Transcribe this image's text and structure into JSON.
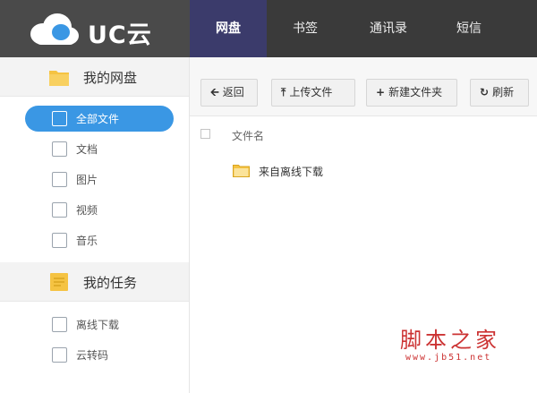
{
  "app": {
    "logo_text": "UC云",
    "logo_icon": "cloud-logo-icon"
  },
  "nav": {
    "items": [
      {
        "label": "网盘",
        "active": true
      },
      {
        "label": "书签",
        "active": false
      },
      {
        "label": "通讯录",
        "active": false
      },
      {
        "label": "短信",
        "active": false
      }
    ]
  },
  "sidebar": {
    "disk": {
      "title": "我的网盘",
      "items": [
        {
          "label": "全部文件",
          "icon": "all-files-icon",
          "active": true
        },
        {
          "label": "文档",
          "icon": "document-icon",
          "active": false
        },
        {
          "label": "图片",
          "icon": "picture-icon",
          "active": false
        },
        {
          "label": "视频",
          "icon": "video-icon",
          "active": false
        },
        {
          "label": "音乐",
          "icon": "music-icon",
          "active": false
        }
      ]
    },
    "tasks": {
      "title": "我的任务",
      "items": [
        {
          "label": "离线下载",
          "icon": "offline-download-icon"
        },
        {
          "label": "云转码",
          "icon": "cloud-transcode-icon"
        }
      ]
    }
  },
  "toolbar": {
    "back": "返回",
    "upload": "上传文件",
    "new_folder": "新建文件夹",
    "refresh": "刷新"
  },
  "file_list": {
    "column_name": "文件名",
    "rows": [
      {
        "name": "来自离线下载",
        "icon": "folder-icon"
      }
    ]
  },
  "watermark": {
    "title": "脚本之家",
    "url": "www.jb51.net"
  },
  "colors": {
    "accent": "#3a97e4",
    "topbar": "#3a3a3a",
    "nav_active": "#3b3b6b",
    "folder": "#f5c342",
    "watermark": "#cc3333"
  }
}
